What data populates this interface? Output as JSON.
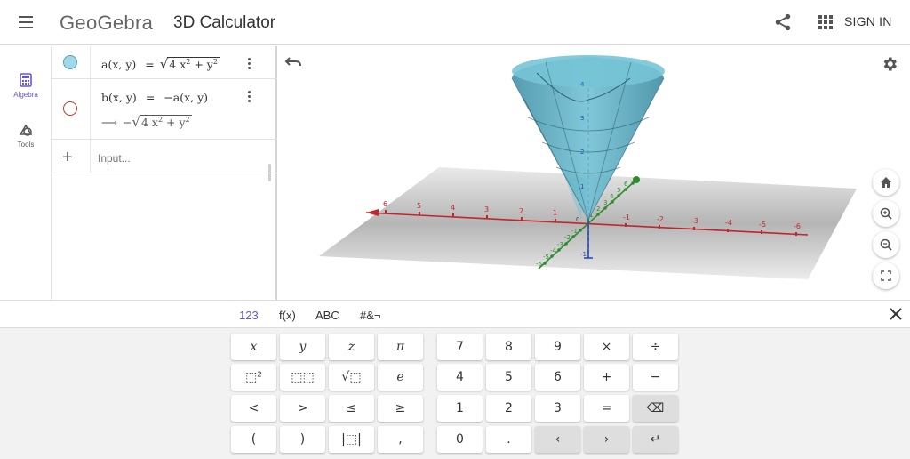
{
  "header": {
    "logo": "GeoGebra",
    "app_title": "3D Calculator",
    "signin_label": "SIGN IN"
  },
  "rail": {
    "items": [
      {
        "label": "Algebra",
        "icon": "calculator-icon",
        "active": true
      },
      {
        "label": "Tools",
        "icon": "tools-icon",
        "active": false
      }
    ]
  },
  "algebra": {
    "rows": [
      {
        "name": "a",
        "lhs": "a(x, y)",
        "eq": "=",
        "rhs_prefix": "",
        "radicand_a": "4 x",
        "radicand_b": " + y",
        "color": "#9fd9ea",
        "visible": true
      },
      {
        "name": "b",
        "lhs": "b(x, y)",
        "eq": "=",
        "rhs": "−a(x, y)",
        "arrow": "⟶",
        "sub_prefix": "−",
        "radicand_a": "4 x",
        "radicand_b": " + y",
        "color": "#c0392b",
        "visible": false
      }
    ],
    "exponent": "2",
    "input_placeholder": "Input..."
  },
  "graphics": {
    "x_axis_ticks": [
      "6",
      "5",
      "4",
      "3",
      "2",
      "1",
      "-1",
      "-2",
      "-3",
      "-4",
      "-5",
      "-6"
    ],
    "y_axis_ticks": [
      "6",
      "5",
      "4",
      "3",
      "2",
      "1",
      "-1",
      "-2",
      "-3",
      "-4",
      "-5",
      "-6"
    ],
    "z_axis_ticks": [
      "4",
      "3",
      "2",
      "1",
      "-1"
    ],
    "origin_label": "0",
    "colors": {
      "x_axis": "#c0262d",
      "y_axis": "#2e8b2e",
      "z_axis": "#2d4fb5",
      "surface": "#4aa3bb",
      "plane": "#c8c8c8"
    }
  },
  "keyboard": {
    "tabs": [
      "123",
      "f(x)",
      "ABC",
      "#&¬"
    ],
    "rows": [
      [
        "x",
        "y",
        "z",
        "π",
        "7",
        "8",
        "9",
        "×",
        "÷"
      ],
      [
        "⬚²",
        "⬚⬚",
        "√⬚",
        "e",
        "4",
        "5",
        "6",
        "+",
        "−"
      ],
      [
        "<",
        ">",
        "≤",
        "≥",
        "1",
        "2",
        "3",
        "=",
        "⌫"
      ],
      [
        "(",
        ")",
        "|⬚|",
        ",",
        "0",
        ".",
        "‹",
        "›",
        "↵"
      ]
    ]
  }
}
